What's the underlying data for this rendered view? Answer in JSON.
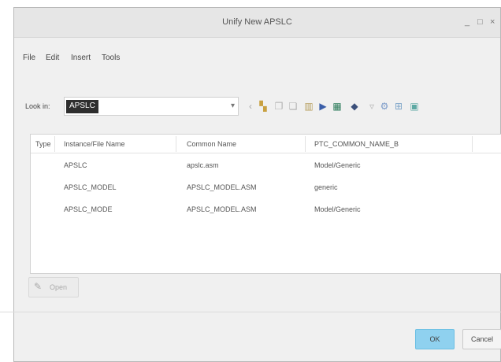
{
  "window": {
    "title": "Unify New APSLC",
    "controls": [
      "_",
      "□",
      "×"
    ]
  },
  "menu": [
    "File",
    "Edit",
    "Insert",
    "Tools"
  ],
  "toolbar": {
    "look_in_label": "Look in:",
    "look_in_value": "APSLC"
  },
  "table": {
    "columns": [
      "Type",
      "Instance/File Name",
      "Common Name",
      "PTC_COMMON_NAME_B"
    ],
    "rows": [
      [
        "",
        "APSLC",
        "apslc.asm",
        "Model/Generic"
      ],
      [
        "",
        "APSLC_MODEL",
        "APSLC_MODEL.ASM",
        "generic"
      ],
      [
        "",
        "APSLC_MODE",
        "APSLC_MODEL.ASM",
        "Model/Generic"
      ]
    ]
  },
  "open_button": "Open",
  "ok_button": "OK",
  "cancel_button": "Cancel"
}
